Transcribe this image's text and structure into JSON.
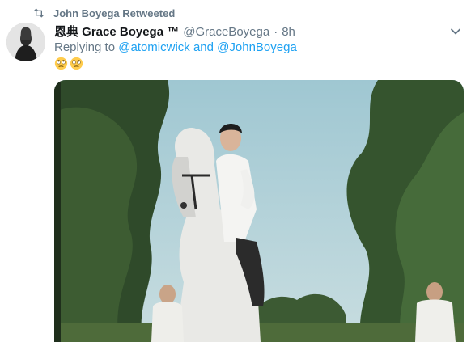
{
  "retweet": {
    "label": "John Boyega Retweeted",
    "icon": "retweet-icon"
  },
  "tweet": {
    "display_name": "恩典 Grace Boyega ™",
    "handle": "@GraceBoyega",
    "separator": "·",
    "time": "8h",
    "replying_prefix": "Replying to",
    "mention_1": "@atomicwick",
    "conjunction": "and",
    "mention_2": "@JohnBoyega",
    "emojis": [
      "face-with-rolling-eyes",
      "face-with-rolling-eyes"
    ],
    "media_description_icon": "video-thumbnail"
  },
  "colors": {
    "link": "#1da1f2",
    "secondary_text": "#657786",
    "primary_text": "#14171a"
  }
}
